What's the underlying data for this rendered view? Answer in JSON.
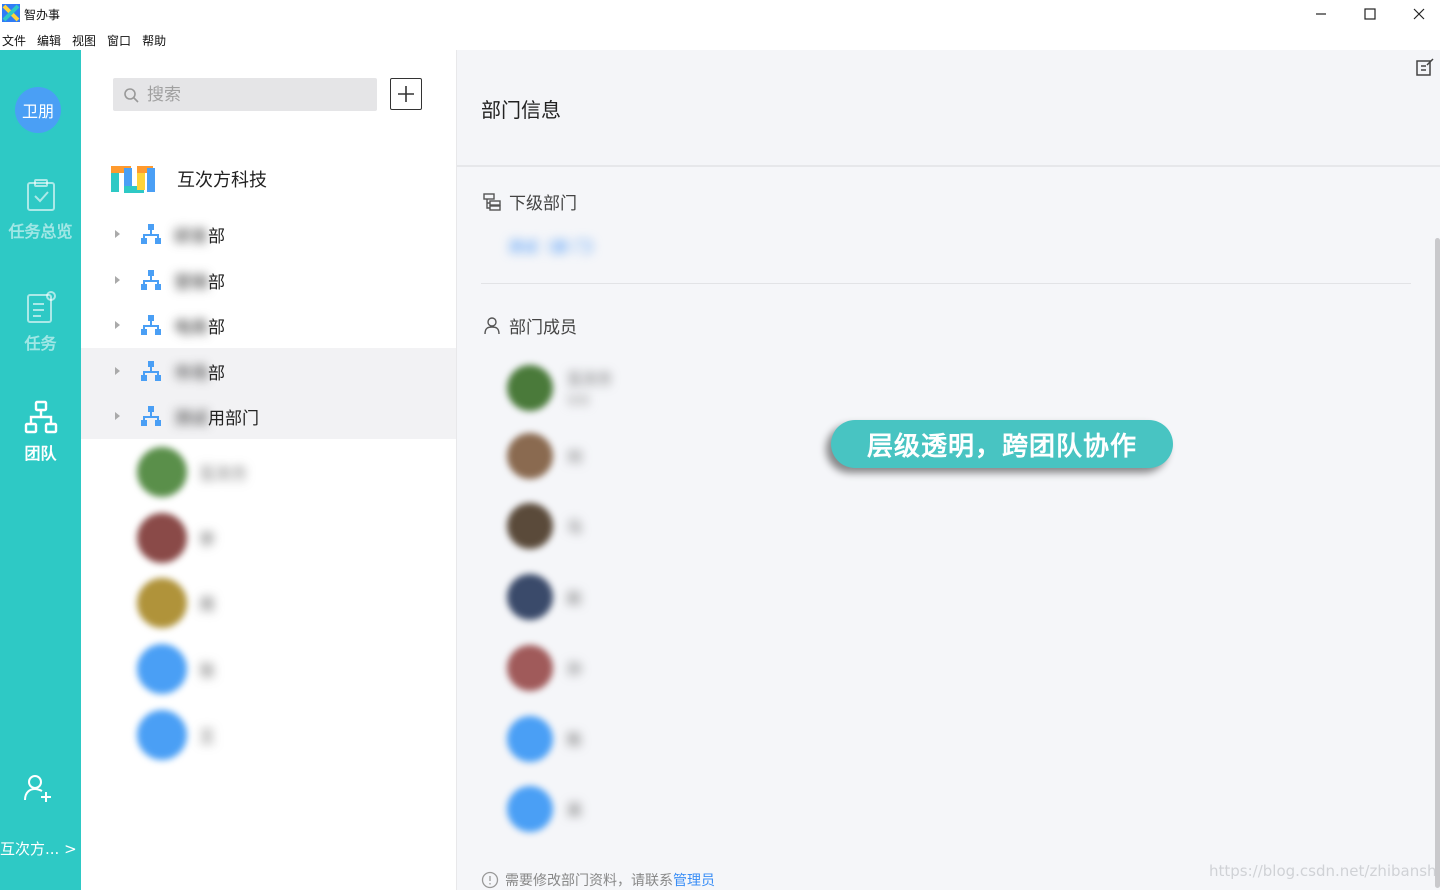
{
  "window": {
    "title": "智办事"
  },
  "menu": [
    "文件",
    "编辑",
    "视图",
    "窗口",
    "帮助"
  ],
  "rail": {
    "avatar_text": "卫朋",
    "nav": [
      {
        "label": "任务总览",
        "icon": "clipboard-check-icon",
        "active": false
      },
      {
        "label": "任务",
        "icon": "task-list-icon",
        "active": false
      },
      {
        "label": "团队",
        "icon": "org-tree-icon",
        "active": true
      }
    ],
    "org_switch_label": "互次方..."
  },
  "middle": {
    "search_placeholder": "搜索",
    "org_name": "互次方科技",
    "departments": [
      {
        "blurred_prefix": "研发",
        "suffix": "部"
      },
      {
        "blurred_prefix": "营销",
        "suffix": "部"
      },
      {
        "blurred_prefix": "电商",
        "suffix": "部"
      },
      {
        "blurred_prefix": "市场",
        "suffix": "部"
      },
      {
        "blurred_prefix": "测试",
        "suffix": "用部门"
      }
    ],
    "members": [
      {
        "name": "互次方",
        "avatar_color": "#5a8f4a"
      },
      {
        "name": "李",
        "avatar_color": "#8a4a48"
      },
      {
        "name": "周",
        "avatar_color": "#b0933a"
      },
      {
        "name": "张",
        "avatar_color": "#4a9ff5"
      },
      {
        "name": "王",
        "avatar_color": "#4a9ff5"
      }
    ]
  },
  "right": {
    "title": "部门信息",
    "sub_section_label": "下级部门",
    "sub_dept_link": "测试（部 门）",
    "members_section_label": "部门成员",
    "members": [
      {
        "name": "互次方",
        "sub": "管理",
        "avatar_color": "#4a7a3a"
      },
      {
        "name": "刘",
        "sub": "",
        "avatar_color": "#8a6a50"
      },
      {
        "name": "马",
        "sub": "",
        "avatar_color": "#5a4a3a"
      },
      {
        "name": "赵",
        "sub": "",
        "avatar_color": "#3a4a6a"
      },
      {
        "name": "孙",
        "sub": "",
        "avatar_color": "#a05a5a"
      },
      {
        "name": "陈",
        "sub": "",
        "avatar_color": "#4a9ff5"
      },
      {
        "name": "吴",
        "sub": "",
        "avatar_color": "#4a9ff5"
      }
    ],
    "footnote_text": "需要修改部门资料，请联系",
    "footnote_link": "管理员",
    "banner_text": "层级透明，跨团队协作",
    "watermark": "https://blog.csdn.net/zhibanshi_"
  },
  "colors": {
    "rail": "#2ec9c5",
    "accent_blue": "#4a9ff5",
    "banner": "#48c4c2"
  }
}
